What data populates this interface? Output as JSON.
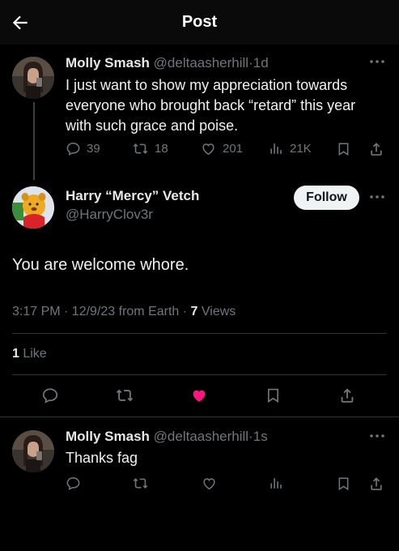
{
  "header": {
    "title": "Post"
  },
  "reply_to": {
    "display_name": "Molly Smash",
    "handle": "@deltaasherhill",
    "dot": "·",
    "time": "1d",
    "text_lines": [
      "I just want to show my appreciation towards",
      "everyone who brought back “retard” this year",
      "with such grace and poise."
    ],
    "stats": {
      "replies": "39",
      "reposts": "18",
      "likes": "201",
      "views": "21K"
    }
  },
  "main_post": {
    "display_name": "Harry “Mercy” Vetch",
    "handle": "@HarryClov3r",
    "follow_label": "Follow",
    "text": "You are welcome whore.",
    "timestamp": "3:17 PM · 12/9/23 from Earth · ",
    "views_count": "7",
    "views_label": " Views",
    "likes_count": "1",
    "likes_label": " Like",
    "liked": true
  },
  "reply": {
    "display_name": "Molly Smash",
    "handle": "@deltaasherhill",
    "dot": "·",
    "time": "1s",
    "text": "Thanks fag"
  },
  "colors": {
    "background": "#000000",
    "text": "#e7e9ea",
    "muted": "#71767b",
    "like_active": "#f91880",
    "divider": "#2f3336"
  },
  "icons": [
    "back-arrow-icon",
    "more-icon",
    "reply-icon",
    "repost-icon",
    "like-icon",
    "views-icon",
    "bookmark-icon",
    "share-icon"
  ]
}
